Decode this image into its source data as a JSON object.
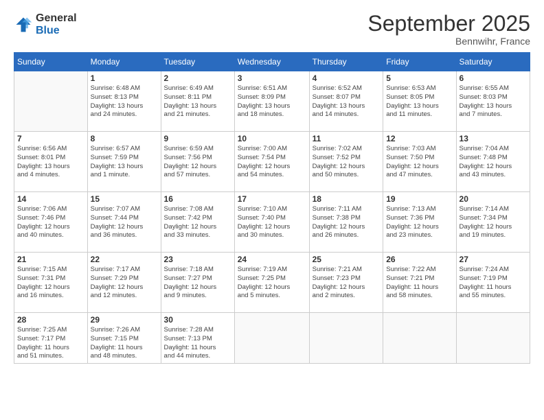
{
  "header": {
    "logo_line1": "General",
    "logo_line2": "Blue",
    "month_title": "September 2025",
    "location": "Bennwihr, France"
  },
  "days_of_week": [
    "Sunday",
    "Monday",
    "Tuesday",
    "Wednesday",
    "Thursday",
    "Friday",
    "Saturday"
  ],
  "weeks": [
    [
      {
        "day": "",
        "info": ""
      },
      {
        "day": "1",
        "info": "Sunrise: 6:48 AM\nSunset: 8:13 PM\nDaylight: 13 hours\nand 24 minutes."
      },
      {
        "day": "2",
        "info": "Sunrise: 6:49 AM\nSunset: 8:11 PM\nDaylight: 13 hours\nand 21 minutes."
      },
      {
        "day": "3",
        "info": "Sunrise: 6:51 AM\nSunset: 8:09 PM\nDaylight: 13 hours\nand 18 minutes."
      },
      {
        "day": "4",
        "info": "Sunrise: 6:52 AM\nSunset: 8:07 PM\nDaylight: 13 hours\nand 14 minutes."
      },
      {
        "day": "5",
        "info": "Sunrise: 6:53 AM\nSunset: 8:05 PM\nDaylight: 13 hours\nand 11 minutes."
      },
      {
        "day": "6",
        "info": "Sunrise: 6:55 AM\nSunset: 8:03 PM\nDaylight: 13 hours\nand 7 minutes."
      }
    ],
    [
      {
        "day": "7",
        "info": "Sunrise: 6:56 AM\nSunset: 8:01 PM\nDaylight: 13 hours\nand 4 minutes."
      },
      {
        "day": "8",
        "info": "Sunrise: 6:57 AM\nSunset: 7:59 PM\nDaylight: 13 hours\nand 1 minute."
      },
      {
        "day": "9",
        "info": "Sunrise: 6:59 AM\nSunset: 7:56 PM\nDaylight: 12 hours\nand 57 minutes."
      },
      {
        "day": "10",
        "info": "Sunrise: 7:00 AM\nSunset: 7:54 PM\nDaylight: 12 hours\nand 54 minutes."
      },
      {
        "day": "11",
        "info": "Sunrise: 7:02 AM\nSunset: 7:52 PM\nDaylight: 12 hours\nand 50 minutes."
      },
      {
        "day": "12",
        "info": "Sunrise: 7:03 AM\nSunset: 7:50 PM\nDaylight: 12 hours\nand 47 minutes."
      },
      {
        "day": "13",
        "info": "Sunrise: 7:04 AM\nSunset: 7:48 PM\nDaylight: 12 hours\nand 43 minutes."
      }
    ],
    [
      {
        "day": "14",
        "info": "Sunrise: 7:06 AM\nSunset: 7:46 PM\nDaylight: 12 hours\nand 40 minutes."
      },
      {
        "day": "15",
        "info": "Sunrise: 7:07 AM\nSunset: 7:44 PM\nDaylight: 12 hours\nand 36 minutes."
      },
      {
        "day": "16",
        "info": "Sunrise: 7:08 AM\nSunset: 7:42 PM\nDaylight: 12 hours\nand 33 minutes."
      },
      {
        "day": "17",
        "info": "Sunrise: 7:10 AM\nSunset: 7:40 PM\nDaylight: 12 hours\nand 30 minutes."
      },
      {
        "day": "18",
        "info": "Sunrise: 7:11 AM\nSunset: 7:38 PM\nDaylight: 12 hours\nand 26 minutes."
      },
      {
        "day": "19",
        "info": "Sunrise: 7:13 AM\nSunset: 7:36 PM\nDaylight: 12 hours\nand 23 minutes."
      },
      {
        "day": "20",
        "info": "Sunrise: 7:14 AM\nSunset: 7:34 PM\nDaylight: 12 hours\nand 19 minutes."
      }
    ],
    [
      {
        "day": "21",
        "info": "Sunrise: 7:15 AM\nSunset: 7:31 PM\nDaylight: 12 hours\nand 16 minutes."
      },
      {
        "day": "22",
        "info": "Sunrise: 7:17 AM\nSunset: 7:29 PM\nDaylight: 12 hours\nand 12 minutes."
      },
      {
        "day": "23",
        "info": "Sunrise: 7:18 AM\nSunset: 7:27 PM\nDaylight: 12 hours\nand 9 minutes."
      },
      {
        "day": "24",
        "info": "Sunrise: 7:19 AM\nSunset: 7:25 PM\nDaylight: 12 hours\nand 5 minutes."
      },
      {
        "day": "25",
        "info": "Sunrise: 7:21 AM\nSunset: 7:23 PM\nDaylight: 12 hours\nand 2 minutes."
      },
      {
        "day": "26",
        "info": "Sunrise: 7:22 AM\nSunset: 7:21 PM\nDaylight: 11 hours\nand 58 minutes."
      },
      {
        "day": "27",
        "info": "Sunrise: 7:24 AM\nSunset: 7:19 PM\nDaylight: 11 hours\nand 55 minutes."
      }
    ],
    [
      {
        "day": "28",
        "info": "Sunrise: 7:25 AM\nSunset: 7:17 PM\nDaylight: 11 hours\nand 51 minutes."
      },
      {
        "day": "29",
        "info": "Sunrise: 7:26 AM\nSunset: 7:15 PM\nDaylight: 11 hours\nand 48 minutes."
      },
      {
        "day": "30",
        "info": "Sunrise: 7:28 AM\nSunset: 7:13 PM\nDaylight: 11 hours\nand 44 minutes."
      },
      {
        "day": "",
        "info": ""
      },
      {
        "day": "",
        "info": ""
      },
      {
        "day": "",
        "info": ""
      },
      {
        "day": "",
        "info": ""
      }
    ]
  ]
}
